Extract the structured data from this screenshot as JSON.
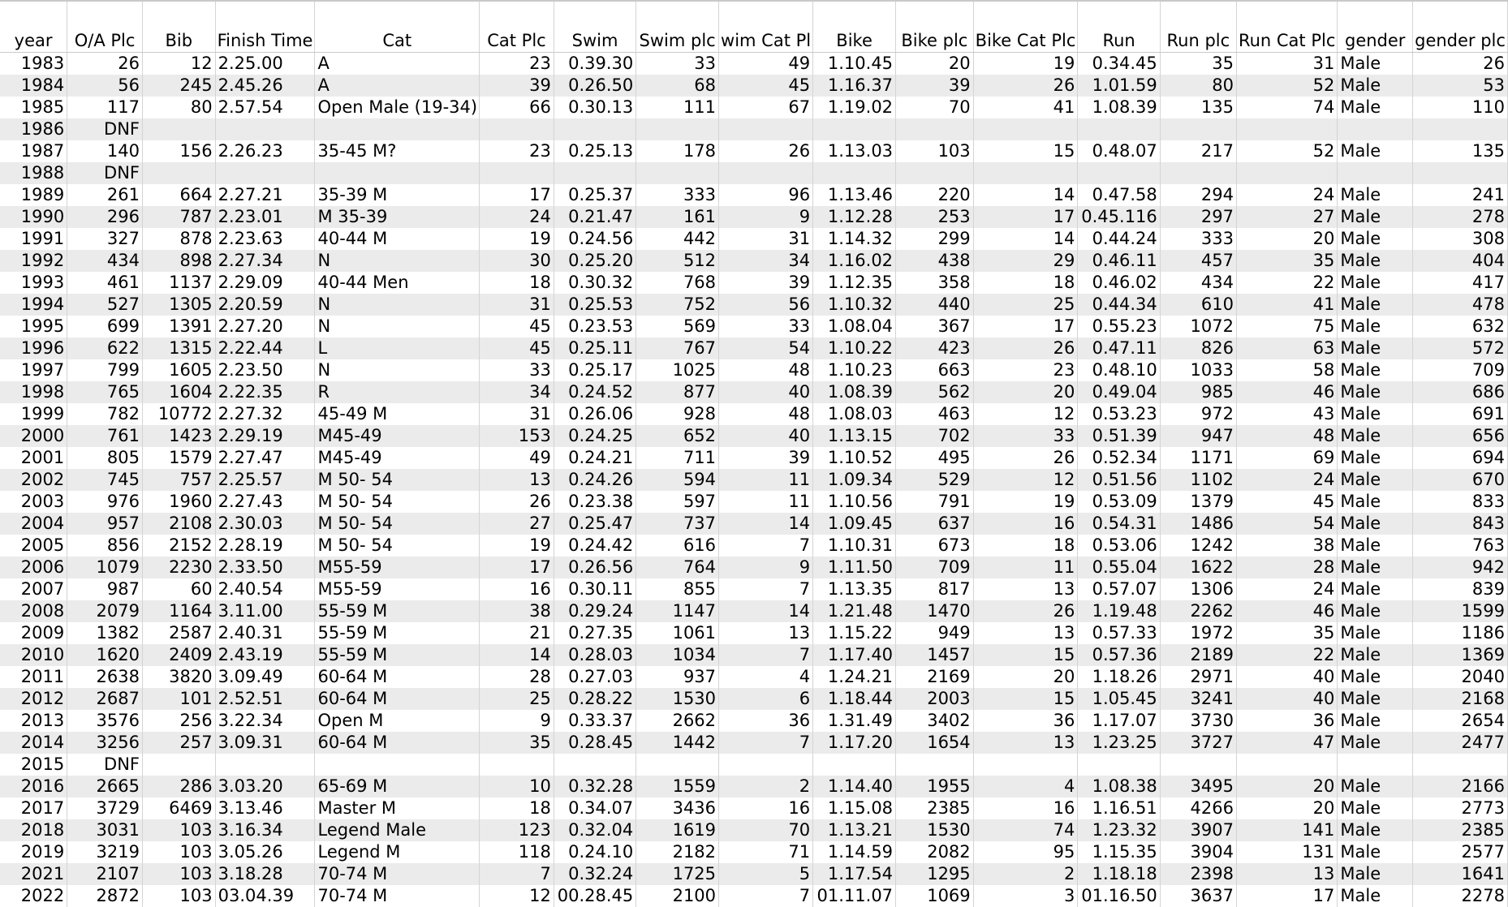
{
  "spreadsheet": {
    "headers": [
      "year",
      "O/A Plc",
      "Bib",
      "Finish Time",
      "Cat",
      "Cat Plc",
      "Swim",
      "Swim plc",
      "wim Cat Pl",
      "Bike",
      "Bike plc",
      "Bike Cat Plc",
      "Run",
      "Run plc",
      "Run Cat Plc",
      "gender",
      "gender plc"
    ],
    "rows": [
      [
        "1983",
        "26",
        "12",
        "2.25.00",
        "A",
        "23",
        "0.39.30",
        "33",
        "49",
        "1.10.45",
        "20",
        "19",
        "0.34.45",
        "35",
        "31",
        "Male",
        "26"
      ],
      [
        "1984",
        "56",
        "245",
        "2.45.26",
        "A",
        "39",
        "0.26.50",
        "68",
        "45",
        "1.16.37",
        "39",
        "26",
        "1.01.59",
        "80",
        "52",
        "Male",
        "53"
      ],
      [
        "1985",
        "117",
        "80",
        "2.57.54",
        "Open Male (19-34)",
        "66",
        "0.30.13",
        "111",
        "67",
        "1.19.02",
        "70",
        "41",
        "1.08.39",
        "135",
        "74",
        "Male",
        "110"
      ],
      [
        "1986",
        "DNF",
        "",
        "",
        "",
        "",
        "",
        "",
        "",
        "",
        "",
        "",
        "",
        "",
        "",
        "",
        ""
      ],
      [
        "1987",
        "140",
        "156",
        "2.26.23",
        "35-45 M?",
        "23",
        "0.25.13",
        "178",
        "26",
        "1.13.03",
        "103",
        "15",
        "0.48.07",
        "217",
        "52",
        "Male",
        "135"
      ],
      [
        "1988",
        "DNF",
        "",
        "",
        "",
        "",
        "",
        "",
        "",
        "",
        "",
        "",
        "",
        "",
        "",
        "",
        ""
      ],
      [
        "1989",
        "261",
        "664",
        "2.27.21",
        "35-39 M",
        "17",
        "0.25.37",
        "333",
        "96",
        "1.13.46",
        "220",
        "14",
        "0.47.58",
        "294",
        "24",
        "Male",
        "241"
      ],
      [
        "1990",
        "296",
        "787",
        "2.23.01",
        "M 35-39",
        "24",
        "0.21.47",
        "161",
        "9",
        "1.12.28",
        "253",
        "17",
        "0.45.116",
        "297",
        "27",
        "Male",
        "278"
      ],
      [
        "1991",
        "327",
        "878",
        "2.23.63",
        "40-44 M",
        "19",
        "0.24.56",
        "442",
        "31",
        "1.14.32",
        "299",
        "14",
        "0.44.24",
        "333",
        "20",
        "Male",
        "308"
      ],
      [
        "1992",
        "434",
        "898",
        "2.27.34",
        "N",
        "30",
        "0.25.20",
        "512",
        "34",
        "1.16.02",
        "438",
        "29",
        "0.46.11",
        "457",
        "35",
        "Male",
        "404"
      ],
      [
        "1993",
        "461",
        "1137",
        "2.29.09",
        "40-44 Men",
        "18",
        "0.30.32",
        "768",
        "39",
        "1.12.35",
        "358",
        "18",
        "0.46.02",
        "434",
        "22",
        "Male",
        "417"
      ],
      [
        "1994",
        "527",
        "1305",
        "2.20.59",
        "N",
        "31",
        "0.25.53",
        "752",
        "56",
        "1.10.32",
        "440",
        "25",
        "0.44.34",
        "610",
        "41",
        "Male",
        "478"
      ],
      [
        "1995",
        "699",
        "1391",
        "2.27.20",
        "N",
        "45",
        "0.23.53",
        "569",
        "33",
        "1.08.04",
        "367",
        "17",
        "0.55.23",
        "1072",
        "75",
        "Male",
        "632"
      ],
      [
        "1996",
        "622",
        "1315",
        "2.22.44",
        "L",
        "45",
        "0.25.11",
        "767",
        "54",
        "1.10.22",
        "423",
        "26",
        "0.47.11",
        "826",
        "63",
        "Male",
        "572"
      ],
      [
        "1997",
        "799",
        "1605",
        "2.23.50",
        "N",
        "33",
        "0.25.17",
        "1025",
        "48",
        "1.10.23",
        "663",
        "23",
        "0.48.10",
        "1033",
        "58",
        "Male",
        "709"
      ],
      [
        "1998",
        "765",
        "1604",
        "2.22.35",
        "R",
        "34",
        "0.24.52",
        "877",
        "40",
        "1.08.39",
        "562",
        "20",
        "0.49.04",
        "985",
        "46",
        "Male",
        "686"
      ],
      [
        "1999",
        "782",
        "10772",
        "2.27.32",
        "45-49 M",
        "31",
        "0.26.06",
        "928",
        "48",
        "1.08.03",
        "463",
        "12",
        "0.53.23",
        "972",
        "43",
        "Male",
        "691"
      ],
      [
        "2000",
        "761",
        "1423",
        "2.29.19",
        "M45-49",
        "153",
        "0.24.25",
        "652",
        "40",
        "1.13.15",
        "702",
        "33",
        "0.51.39",
        "947",
        "48",
        "Male",
        "656"
      ],
      [
        "2001",
        "805",
        "1579",
        "2.27.47",
        "M45-49",
        "49",
        "0.24.21",
        "711",
        "39",
        "1.10.52",
        "495",
        "26",
        "0.52.34",
        "1171",
        "69",
        "Male",
        "694"
      ],
      [
        "2002",
        "745",
        "757",
        "2.25.57",
        "M 50- 54",
        "13",
        "0.24.26",
        "594",
        "11",
        "1.09.34",
        "529",
        "12",
        "0.51.56",
        "1102",
        "24",
        "Male",
        "670"
      ],
      [
        "2003",
        "976",
        "1960",
        "2.27.43",
        "M 50- 54",
        "26",
        "0.23.38",
        "597",
        "11",
        "1.10.56",
        "791",
        "19",
        "0.53.09",
        "1379",
        "45",
        "Male",
        "833"
      ],
      [
        "2004",
        "957",
        "2108",
        "2.30.03",
        "M 50- 54",
        "27",
        "0.25.47",
        "737",
        "14",
        "1.09.45",
        "637",
        "16",
        "0.54.31",
        "1486",
        "54",
        "Male",
        "843"
      ],
      [
        "2005",
        "856",
        "2152",
        "2.28.19",
        "M 50- 54",
        "19",
        "0.24.42",
        "616",
        "7",
        "1.10.31",
        "673",
        "18",
        "0.53.06",
        "1242",
        "38",
        "Male",
        "763"
      ],
      [
        "2006",
        "1079",
        "2230",
        "2.33.50",
        "M55-59",
        "17",
        "0.26.56",
        "764",
        "9",
        "1.11.50",
        "709",
        "11",
        "0.55.04",
        "1622",
        "28",
        "Male",
        "942"
      ],
      [
        "2007",
        "987",
        "60",
        "2.40.54",
        "M55-59",
        "16",
        "0.30.11",
        "855",
        "7",
        "1.13.35",
        "817",
        "13",
        "0.57.07",
        "1306",
        "24",
        "Male",
        "839"
      ],
      [
        "2008",
        "2079",
        "1164",
        "3.11.00",
        "55-59 M",
        "38",
        "0.29.24",
        "1147",
        "14",
        "1.21.48",
        "1470",
        "26",
        "1.19.48",
        "2262",
        "46",
        "Male",
        "1599"
      ],
      [
        "2009",
        "1382",
        "2587",
        "2.40.31",
        "55-59 M",
        "21",
        "0.27.35",
        "1061",
        "13",
        "1.15.22",
        "949",
        "13",
        "0.57.33",
        "1972",
        "35",
        "Male",
        "1186"
      ],
      [
        "2010",
        "1620",
        "2409",
        "2.43.19",
        "55-59  M",
        "14",
        "0.28.03",
        "1034",
        "7",
        "1.17.40",
        "1457",
        "15",
        "0.57.36",
        "2189",
        "22",
        "Male",
        "1369"
      ],
      [
        "2011",
        "2638",
        "3820",
        "3.09.49",
        "60-64 M",
        "28",
        "0.27.03",
        "937",
        "4",
        "1.24.21",
        "2169",
        "20",
        "1.18.26",
        "2971",
        "40",
        "Male",
        "2040"
      ],
      [
        "2012",
        "2687",
        "101",
        "2.52.51",
        "60-64  M",
        "25",
        "0.28.22",
        "1530",
        "6",
        "1.18.44",
        "2003",
        "15",
        "1.05.45",
        "3241",
        "40",
        "Male",
        "2168"
      ],
      [
        "2013",
        "3576",
        "256",
        "3.22.34",
        "Open M",
        "9",
        "0.33.37",
        "2662",
        "36",
        "1.31.49",
        "3402",
        "36",
        "1.17.07",
        "3730",
        "36",
        "Male",
        "2654"
      ],
      [
        "2014",
        "3256",
        "257",
        "3.09.31",
        "60-64  M",
        "35",
        "0.28.45",
        "1442",
        "7",
        "1.17.20",
        "1654",
        "13",
        "1.23.25",
        "3727",
        "47",
        "Male",
        "2477"
      ],
      [
        "2015",
        "DNF",
        "",
        "",
        "",
        "",
        "",
        "",
        "",
        "",
        "",
        "",
        "",
        "",
        "",
        "",
        ""
      ],
      [
        "2016",
        "2665",
        "286",
        "3.03.20",
        "65-69  M",
        "10",
        "0.32.28",
        "1559",
        "2",
        "1.14.40",
        "1955",
        "4",
        "1.08.38",
        "3495",
        "20",
        "Male",
        "2166"
      ],
      [
        "2017",
        "3729",
        "6469",
        "3.13.46",
        "Master  M",
        "18",
        "0.34.07",
        "3436",
        "16",
        "1.15.08",
        "2385",
        "16",
        "1.16.51",
        "4266",
        "20",
        "Male",
        "2773"
      ],
      [
        "2018",
        "3031",
        "103",
        "3.16.34",
        "Legend Male",
        "123",
        "0.32.04",
        "1619",
        "70",
        "1.13.21",
        "1530",
        "74",
        "1.23.32",
        "3907",
        "141",
        "Male",
        "2385"
      ],
      [
        "2019",
        "3219",
        "103",
        "3.05.26",
        "Legend M",
        "118",
        "0.24.10",
        "2182",
        "71",
        "1.14.59",
        "2082",
        "95",
        "1.15.35",
        "3904",
        "131",
        "Male",
        "2577"
      ],
      [
        "2021",
        "2107",
        "103",
        "3.18.28",
        "70-74 M",
        "7",
        "0.32.24",
        "1725",
        "5",
        "1.17.54",
        "1295",
        "2",
        "1.18.18",
        "2398",
        "13",
        "Male",
        "1641"
      ],
      [
        "2022",
        "2872",
        "103",
        "03.04.39",
        "70-74 M",
        "12",
        "00.28.45",
        "2100",
        "7",
        "01.11.07",
        "1069",
        "3",
        "01.16.50",
        "3637",
        "17",
        "Male",
        "2278"
      ]
    ]
  }
}
